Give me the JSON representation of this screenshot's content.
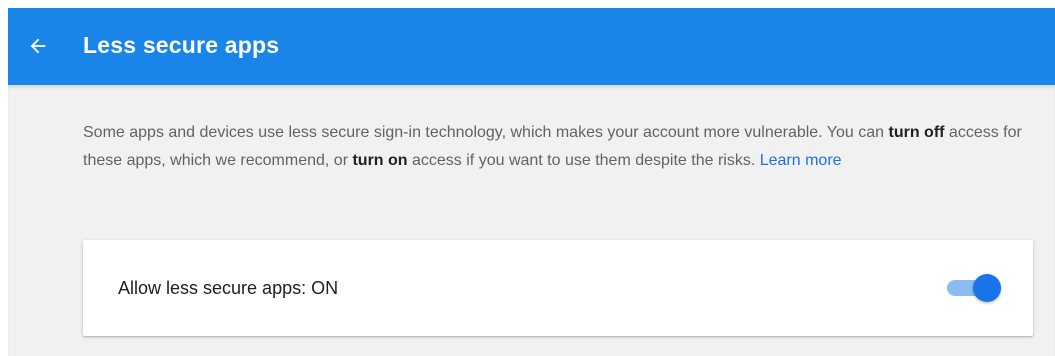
{
  "header": {
    "title": "Less secure apps",
    "back_icon": "arrow-left-icon",
    "color": "#1a85e8"
  },
  "description": {
    "part1": "Some apps and devices use less secure sign-in technology, which makes your account more vulnerable. You can ",
    "turn_off": "turn off",
    "part2": " access for these apps, which we recommend, or ",
    "turn_on": "turn on",
    "part3": " access if you want to use them despite the risks. ",
    "learn_more": "Learn more",
    "link_color": "#1a73e8"
  },
  "setting": {
    "label": "Allow less secure apps: ON",
    "state": "on",
    "toggle_color": "#1a73e8"
  }
}
